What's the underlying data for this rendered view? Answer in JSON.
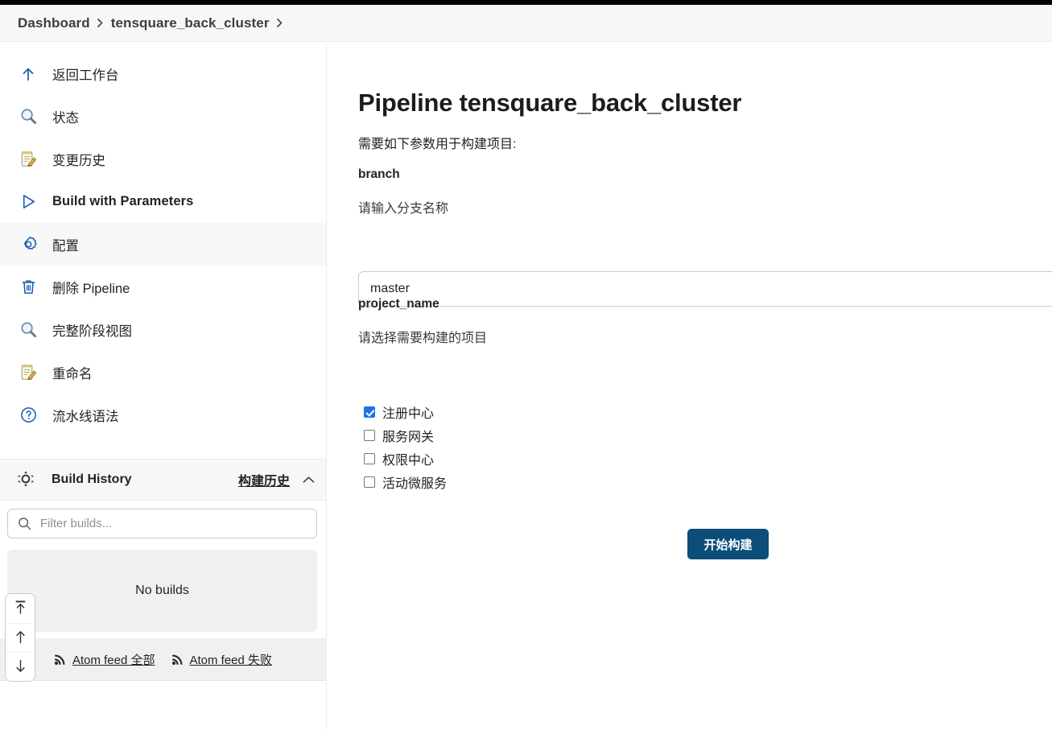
{
  "breadcrumb": {
    "items": [
      {
        "label": "Dashboard",
        "name": "breadcrumb-dashboard"
      },
      {
        "label": "tensquare_back_cluster",
        "name": "breadcrumb-job"
      }
    ],
    "separator_icon": "chevron-right-icon"
  },
  "sidebar": {
    "items": [
      {
        "label": "返回工作台",
        "icon": "arrow-up-icon",
        "latin": false,
        "active": false
      },
      {
        "label": "状态",
        "icon": "magnifier-icon",
        "latin": false,
        "active": false
      },
      {
        "label": "变更历史",
        "icon": "notepad-pencil-icon",
        "latin": false,
        "active": false
      },
      {
        "label": "Build with Parameters",
        "icon": "play-triangle-icon",
        "latin": true,
        "active": false
      },
      {
        "label": "配置",
        "icon": "gear-icon",
        "latin": false,
        "active": true
      },
      {
        "label": "删除 Pipeline",
        "icon": "trash-icon",
        "latin": false,
        "active": false
      },
      {
        "label": "完整阶段视图",
        "icon": "magnifier-icon",
        "latin": false,
        "active": false
      },
      {
        "label": "重命名",
        "icon": "notepad-pencil-icon",
        "latin": false,
        "active": false
      },
      {
        "label": "流水线语法",
        "icon": "question-circle-icon",
        "latin": false,
        "active": false
      }
    ],
    "build_history": {
      "title": "Build History",
      "link_label": "构建历史",
      "icon": "build-history-icon",
      "collapse_icon": "chevron-up-icon",
      "filter_placeholder": "Filter builds...",
      "filter_value": "",
      "search_icon": "search-icon",
      "empty_text": "No builds",
      "atom_feeds": [
        {
          "label": "Atom feed 全部",
          "icon": "rss-icon"
        },
        {
          "label": "Atom feed 失败",
          "icon": "rss-icon"
        }
      ]
    }
  },
  "main": {
    "title": "Pipeline tensquare_back_cluster",
    "intro": "需要如下参数用于构建项目:",
    "parameters": [
      {
        "name": "branch",
        "description": "请输入分支名称",
        "type": "string",
        "value": "master",
        "placeholder": ""
      },
      {
        "name": "project_name",
        "description": "请选择需要构建的项目",
        "type": "checkboxes",
        "options": [
          {
            "label": "注册中心",
            "checked": true
          },
          {
            "label": "服务网关",
            "checked": false
          },
          {
            "label": "权限中心",
            "checked": false
          },
          {
            "label": "活动微服务",
            "checked": false
          }
        ]
      }
    ],
    "submit_label": "开始构建"
  },
  "scroll_dock": {
    "buttons": [
      {
        "icon": "scroll-to-top-icon",
        "name": "scroll-to-top-button"
      },
      {
        "icon": "arrow-up-icon",
        "name": "scroll-up-button"
      },
      {
        "icon": "arrow-down-icon",
        "name": "scroll-down-button"
      }
    ]
  },
  "colors": {
    "accent_blue": "#1a73e8",
    "icon_blue": "#1d5fb4",
    "button_navy": "#0c4d79",
    "panel_gray": "#f0f0f0",
    "header_gray": "#f7f7f7",
    "border_gray": "#ebebeb",
    "input_border": "#c3ccd4"
  }
}
